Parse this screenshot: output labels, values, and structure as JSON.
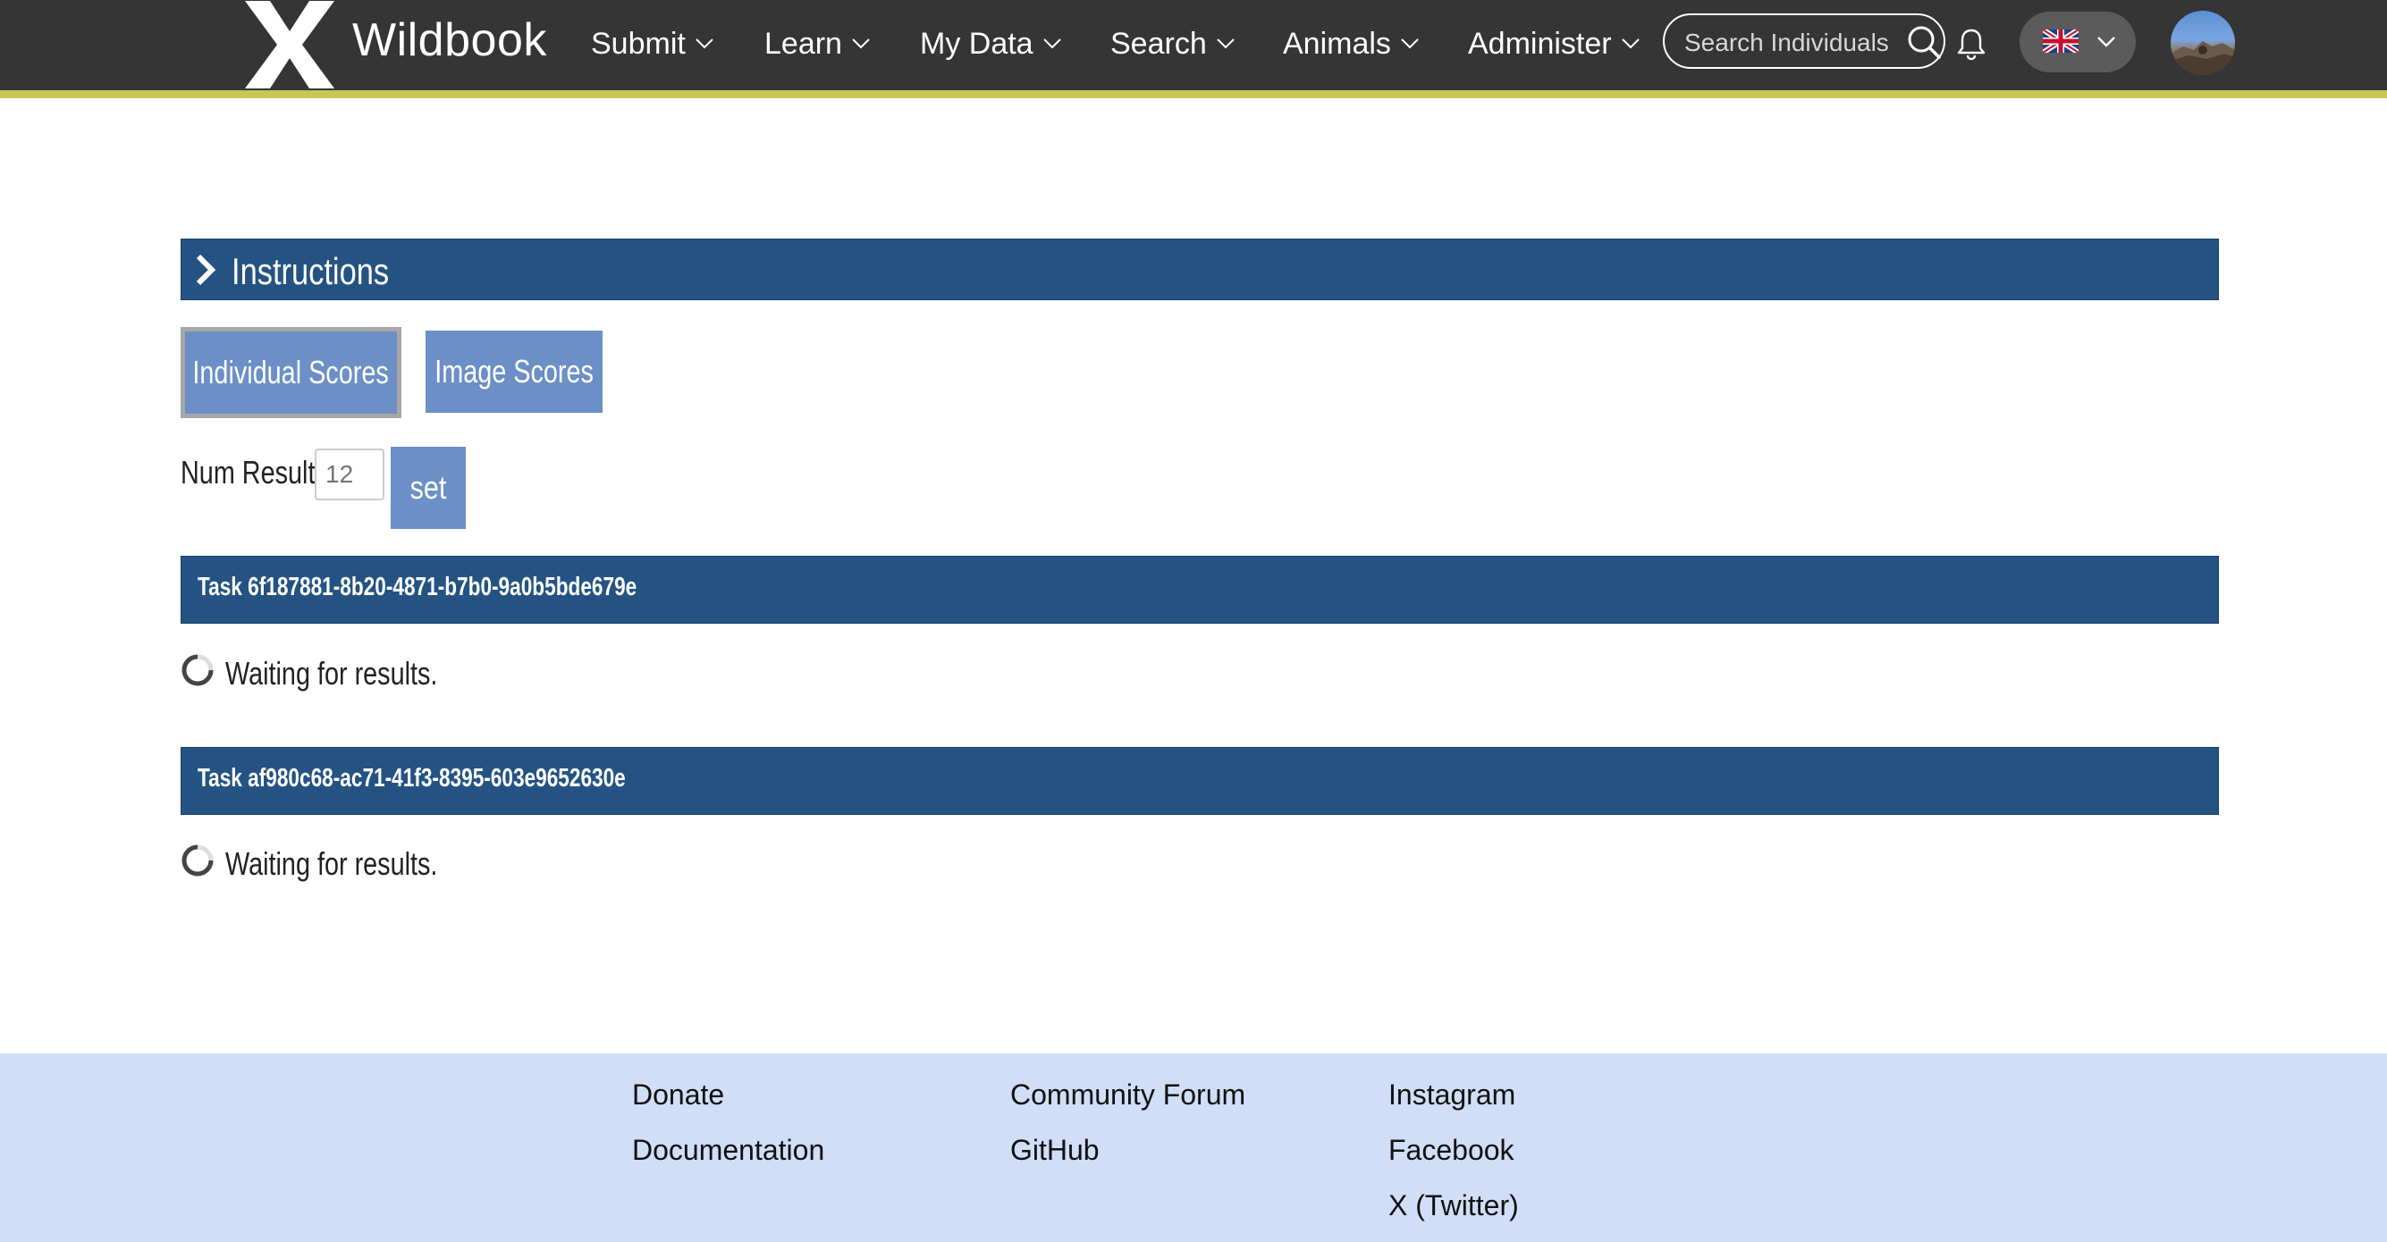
{
  "header": {
    "brand": "Wildbook",
    "nav": [
      {
        "label": "Submit"
      },
      {
        "label": "Learn"
      },
      {
        "label": "My Data"
      },
      {
        "label": "Search"
      },
      {
        "label": "Animals"
      },
      {
        "label": "Administer"
      }
    ],
    "search": {
      "placeholder": "Search Individuals",
      "value": ""
    },
    "language": "en-GB",
    "colors": {
      "navbar": "#353535",
      "stripe": "#c7c753"
    }
  },
  "main": {
    "instructions_label": "Instructions",
    "tabs": [
      {
        "label": "Individual Scores",
        "active": true
      },
      {
        "label": "Image Scores",
        "active": false
      }
    ],
    "num_results": {
      "label": "Num Results:",
      "placeholder": "12",
      "value": "",
      "button": "set"
    },
    "tasks": [
      {
        "title": "Task 6f187881-8b20-4871-b7b0-9a0b5bde679e",
        "status": "Waiting for results."
      },
      {
        "title": "Task af980c68-ac71-41f3-8395-603e9652630e",
        "status": "Waiting for results."
      }
    ],
    "colors": {
      "bar": "#245383",
      "button": "#6b8fc6"
    }
  },
  "footer": {
    "columns": [
      [
        "Donate",
        "Documentation"
      ],
      [
        "Community Forum",
        "GitHub"
      ],
      [
        "Instagram",
        "Facebook",
        "X (Twitter)"
      ]
    ],
    "colors": {
      "background": "#d0def8"
    }
  }
}
